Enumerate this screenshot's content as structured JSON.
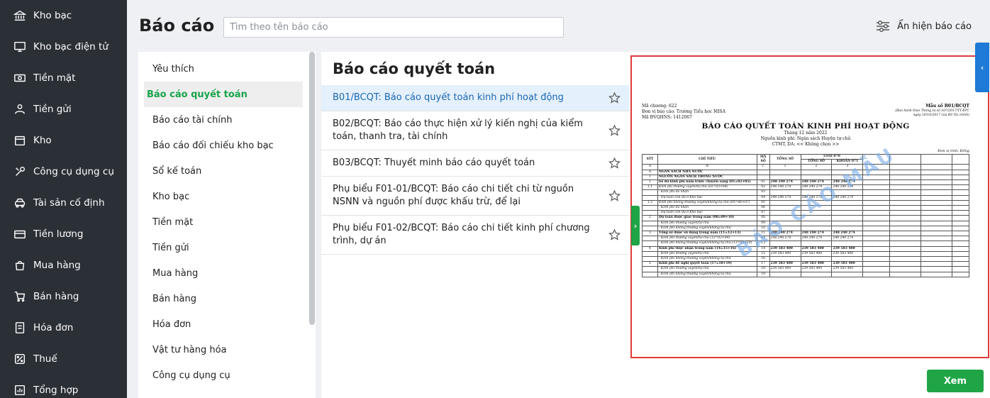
{
  "sidebar": {
    "items": [
      {
        "label": "Kho bạc",
        "icon": "bank-icon"
      },
      {
        "label": "Kho bạc điện tử",
        "icon": "e-treasury-icon"
      },
      {
        "label": "Tiền mặt",
        "icon": "cash-icon"
      },
      {
        "label": "Tiền gửi",
        "icon": "deposit-icon"
      },
      {
        "label": "Kho",
        "icon": "warehouse-icon"
      },
      {
        "label": "Công cụ dụng cụ",
        "icon": "tools-icon"
      },
      {
        "label": "Tài sản cố định",
        "icon": "fixed-asset-icon"
      },
      {
        "label": "Tiền lương",
        "icon": "salary-icon"
      },
      {
        "label": "Mua hàng",
        "icon": "shopping-bag-icon"
      },
      {
        "label": "Bán hàng",
        "icon": "cart-icon"
      },
      {
        "label": "Hóa đơn",
        "icon": "invoice-icon"
      },
      {
        "label": "Thuế",
        "icon": "tax-icon"
      },
      {
        "label": "Tổng hợp",
        "icon": "summary-icon"
      }
    ]
  },
  "header": {
    "title": "Báo cáo",
    "search_placeholder": "Tìm theo tên báo cáo",
    "toggle_label": "Ẩn hiện báo cáo"
  },
  "categories": {
    "active_index": 1,
    "items": [
      "Yêu thích",
      "Báo cáo quyết toán",
      "Báo cáo tài chính",
      "Báo cáo đối chiếu kho bạc",
      "Sổ kế toán",
      "Kho bạc",
      "Tiền mặt",
      "Tiền gửi",
      "Mua hàng",
      "Bán hàng",
      "Hóa đơn",
      "Vật tư hàng hóa",
      "Công cụ dụng cụ"
    ]
  },
  "reports": {
    "title": "Báo cáo quyết toán",
    "selected_index": 0,
    "items": [
      "B01/BCQT: Báo cáo quyết toán kinh phí hoạt động",
      "B02/BCQT: Báo cáo thực hiện xử lý kiến nghị của kiểm toán, thanh tra, tài chính",
      "B03/BCQT: Thuyết minh báo cáo quyết toán",
      "Phụ biểu F01-01/BCQT: Báo cáo chi tiết chi từ nguồn NSNN và nguồn phí được khấu trừ, để lại",
      "Phụ biểu F01-02/BCQT: Báo cáo chi tiết kinh phí chương trình, dự án"
    ]
  },
  "preview": {
    "view_button": "Xem",
    "watermark": "BÁO CÁO MẪU",
    "doc": {
      "left_lines": [
        "Mã chương: 622",
        "Đơn vị báo cáo: Trường Tiểu học MISA",
        "Mã ĐVQHNS: 1412067"
      ],
      "form_no": "Mẫu số B01/BCQT",
      "form_note_1": "(Ban hành theo Thông tư số 107/2017/TT-BTC",
      "form_note_2": "ngày 10/10/2017 của Bộ Tài chính)",
      "title": "BÁO CÁO QUYẾT TOÁN KINH PHÍ HOẠT ĐỘNG",
      "period": "Tháng 12 năm 2022",
      "source": "Nguồn kinh phí: Ngân sách Huyện tự chủ",
      "program": "CTMT, DA: << Không chọn >>",
      "unit": "Đơn vị tính: Đồng",
      "headers": {
        "stt": "STT",
        "chi_tieu": "CHỈ TIÊU",
        "ma_so": "MÃ SỐ",
        "tong_so": "TỔNG SỐ",
        "loai": "LOẠI 070",
        "tong_so_sub": "TỔNG SỐ",
        "khoan": "KHOẢN 071"
      },
      "code_row": [
        "A",
        "B",
        "C",
        "1",
        "2",
        "3"
      ],
      "rows": [
        [
          "A",
          "NGÂN SÁCH NHÀ NƯỚC",
          "",
          "",
          "",
          ""
        ],
        [
          "I",
          "NGUỒN NGÂN SÁCH TRONG NƯỚC",
          "",
          "",
          "",
          ""
        ],
        [
          "1",
          "Số dư kinh phí năm trước chuyển sang (01=02+05)",
          "01",
          "248 240 274",
          "248 240 274",
          "248 240 274"
        ],
        [
          "1.1",
          "Kinh phí thường xuyên/tự chủ (02=03+04)",
          "02",
          "248 240 274",
          "248 240 274",
          "248 240 274"
        ],
        [
          "",
          "- Kinh phí đã nhận",
          "03",
          "",
          "",
          ""
        ],
        [
          "",
          "- Dự toán còn dư ở Kho bạc",
          "04",
          "248 240 274",
          "248 240 274",
          "248 240 274"
        ],
        [
          "1.2",
          "Kinh phí không thường xuyên/không tự chủ (05=06+07)",
          "05",
          "",
          "",
          ""
        ],
        [
          "",
          "- Kinh phí đã nhận",
          "06",
          "",
          "",
          ""
        ],
        [
          "",
          "- Dự toán còn dư ở Kho bạc",
          "07",
          "",
          "",
          ""
        ],
        [
          "2",
          "Dự toán được giao trong năm (08=09+10)",
          "08",
          "",
          "",
          ""
        ],
        [
          "",
          "- Kinh phí thường xuyên/tự chủ",
          "09",
          "",
          "",
          ""
        ],
        [
          "",
          "- Kinh phí không thường xuyên/không tự chủ",
          "10",
          "",
          "",
          ""
        ],
        [
          "3",
          "Tổng số được sử dụng trong năm (11=12+13)",
          "11",
          "248 240 274",
          "248 240 274",
          "248 240 274"
        ],
        [
          "",
          "- Kinh phí thường xuyên/tự chủ (12=02+09)",
          "12",
          "248 240 274",
          "248 240 274",
          "248 240 274"
        ],
        [
          "",
          "- Kinh phí không thường xuyên/không tự chủ (13=05+10)",
          "13",
          "",
          "",
          ""
        ],
        [
          "4",
          "Kinh phí thực nhận trong năm (14=15+16)",
          "14",
          "239 583 400",
          "239 583 400",
          "239 583 400"
        ],
        [
          "",
          "- Kinh phí thường xuyên/tự chủ",
          "15",
          "239 583 400",
          "239 583 400",
          "239 583 400"
        ],
        [
          "",
          "- Kinh phí không thường xuyên/không tự chủ",
          "16",
          "",
          "",
          ""
        ],
        [
          "5",
          "Kinh phí đề nghị quyết toán (17=18+19)",
          "17",
          "239 583 400",
          "239 583 400",
          "239 583 400"
        ],
        [
          "",
          "- Kinh phí thường xuyên/tự chủ",
          "18",
          "239 583 400",
          "239 583 400",
          "239 583 400"
        ],
        [
          "",
          "- Kinh phí không thường xuyên/không tự chủ",
          "19",
          "",
          "",
          ""
        ]
      ]
    }
  }
}
